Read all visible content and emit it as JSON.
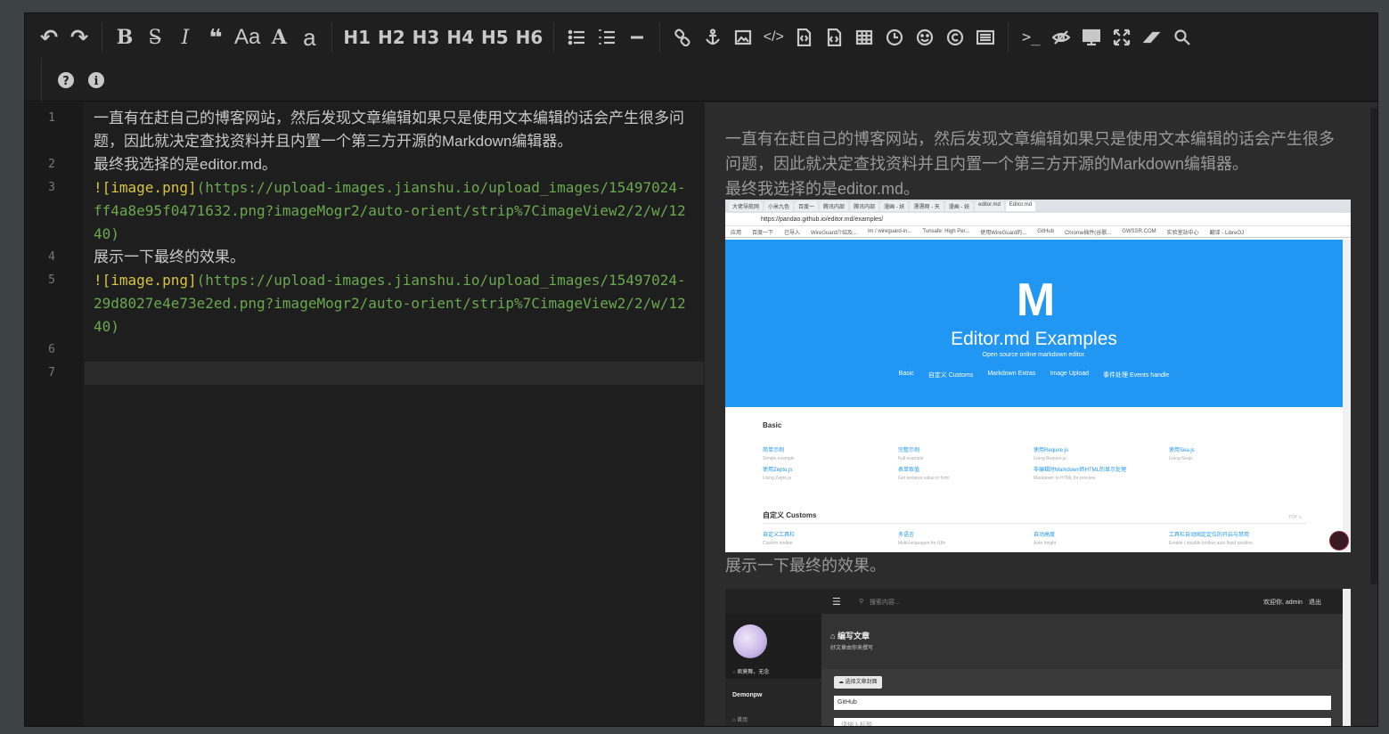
{
  "toolbar": {
    "row1": [
      {
        "name": "undo",
        "glyph": "↶"
      },
      {
        "name": "redo",
        "glyph": "↷"
      },
      {
        "name": "bold",
        "glyph": "B"
      },
      {
        "name": "strikethrough",
        "glyph": "S̶"
      },
      {
        "name": "italic",
        "glyph": "I"
      },
      {
        "name": "quote",
        "glyph": "❝"
      },
      {
        "name": "uppercase",
        "glyph": "Aa"
      },
      {
        "name": "uppercase-first",
        "glyph": "A"
      },
      {
        "name": "lowercase",
        "glyph": "a"
      },
      {
        "name": "h1",
        "glyph": "H1"
      },
      {
        "name": "h2",
        "glyph": "H2"
      },
      {
        "name": "h3",
        "glyph": "H3"
      },
      {
        "name": "h4",
        "glyph": "H4"
      },
      {
        "name": "h5",
        "glyph": "H5"
      },
      {
        "name": "h6",
        "glyph": "H6"
      }
    ],
    "icons": [
      "list-ul-icon",
      "list-ol-icon",
      "hr-icon",
      "link-icon",
      "anchor-icon",
      "image-icon",
      "code-icon",
      "preformatted-text-icon",
      "code-block-icon",
      "table-icon",
      "datetime-icon",
      "emoji-icon",
      "html-entities-icon",
      "pagebreak-icon",
      "goto-line-icon",
      "watch-toggle-icon",
      "preview-icon",
      "fullscreen-icon",
      "clear-icon",
      "search-icon",
      "help-icon",
      "info-icon"
    ]
  },
  "code": {
    "lines": [
      {
        "num": "1",
        "text": "一直有在赶自己的博客网站，然后发现文章编辑如果只是使用文本编辑的话会产生很多问题，因此就决定查找资料并且内置一个第三方开源的Markdown编辑器。"
      },
      {
        "num": "2",
        "text": "最终我选择的是editor.md。"
      },
      {
        "num": "3",
        "alt": "![image.png]",
        "url": "(https://upload-images.jianshu.io/upload_images/15497024-ff4a8e95f0471632.png?imageMogr2/auto-orient/strip%7CimageView2/2/w/1240)"
      },
      {
        "num": "4",
        "text": "展示一下最终的效果。"
      },
      {
        "num": "5",
        "alt": "![image.png]",
        "url": "(https://upload-images.jianshu.io/upload_images/15497024-29d8027e4e73e2ed.png?imageMogr2/auto-orient/strip%7CimageView2/2/w/1240)"
      },
      {
        "num": "6",
        "text": ""
      },
      {
        "num": "7",
        "text": ""
      }
    ]
  },
  "preview": {
    "p1": "一直有在赶自己的博客网站，然后发现文章编辑如果只是使用文本编辑的话会产生很多问题，因此就决定查找资料并且内置一个第三方开源的Markdown编辑器。",
    "p2": "最终我选择的是editor.md。",
    "p3": "展示一下最终的效果。",
    "shot1": {
      "tabs": [
        "大佬导航网",
        "小米九色",
        "百度一",
        "腾讯内部",
        "腾讯内部",
        "漫画 - 妖",
        "漂漂网 - 天",
        "漫画 - 妖",
        "editor.md",
        "Editor.md"
      ],
      "address": "https://pandao.github.io/editor.md/examples/",
      "bookmarks": [
        "应用",
        "百度一下",
        "已导入",
        "WireGuard介绍及...",
        "lm / wireguard-in...",
        "Tunsafe: High Per...",
        "使用WireGuard的...",
        "GitHub",
        "Chrome插件(谷歌...",
        "GWSSR.COM",
        "实验室站中心",
        "翻译 - LibreOJ"
      ],
      "logo": "M",
      "title": "Editor.md Examples",
      "subtitle": "Open source online markdown editor.",
      "nav": [
        "Basic",
        "自定义 Customs",
        "Markdown Extras",
        "Image Upload",
        "事件处理 Events handle"
      ],
      "basic_heading": "Basic",
      "basic_links": [
        {
          "label": "简单示例",
          "sub": "Simple example"
        },
        {
          "label": "完整示例",
          "sub": "Full example"
        },
        {
          "label": "使用Require.js",
          "sub": "Using Require.js"
        },
        {
          "label": "使用Sea.js",
          "sub": "Using Seajs"
        },
        {
          "label": "使用Zepto.js",
          "sub": "Using Zepto.js"
        },
        {
          "label": "表单取值",
          "sub": "Get textarea value in form"
        },
        {
          "label": "非编辑时Markdown转HTML的显示处理",
          "sub": "Markdown to HTML for preview"
        }
      ],
      "custom_heading": "自定义 Customs",
      "top_label": "TOP ∧",
      "custom_links": [
        {
          "label": "自定义工具栏",
          "sub": "Custom toolbar"
        },
        {
          "label": "多语言",
          "sub": "Multi-languages for i18n"
        },
        {
          "label": "自动高度",
          "sub": "Auto height"
        },
        {
          "label": "工具栏自动固定定位的开启与禁用",
          "sub": "Enable / disable toolbar auto fixed position"
        }
      ]
    },
    "shot2": {
      "search_placeholder": "搜索内容...",
      "welcome": "欢迎你, admin",
      "logout": "退出",
      "status": "君莫舞，无念",
      "username": "Demonpw",
      "menu1": "首页",
      "heading": "编写文章",
      "subheading": "好文章由你来撰写",
      "cover_button": "选择文章封面",
      "category": "GitHub",
      "title_placeholder": "请输入标题"
    }
  }
}
